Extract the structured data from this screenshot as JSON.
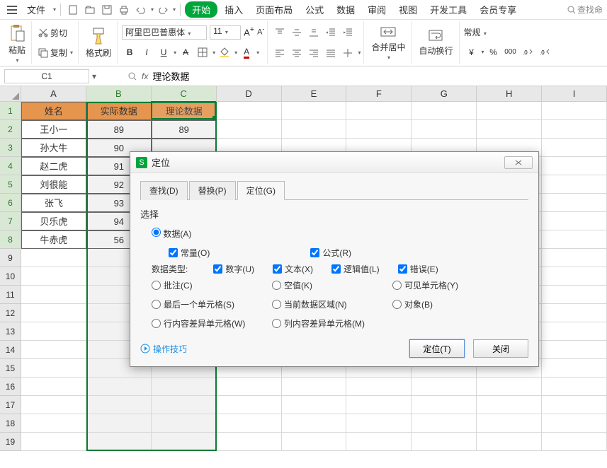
{
  "menubar": {
    "file": "文件",
    "tabs": [
      "开始",
      "插入",
      "页面布局",
      "公式",
      "数据",
      "审阅",
      "视图",
      "开发工具",
      "会员专享"
    ],
    "activeIndex": 0,
    "search_placeholder": "查找命"
  },
  "ribbon": {
    "paste": "粘贴",
    "cut": "剪切",
    "copy": "复制",
    "formatPainter": "格式刷",
    "fontName": "阿里巴巴普惠体",
    "fontSize": "11",
    "merge": "合并居中",
    "wrap": "自动换行",
    "numberFormat": "常规"
  },
  "cellRef": "C1",
  "fxLabel": "fx",
  "formula": "理论数据",
  "columns": [
    "A",
    "B",
    "C",
    "D",
    "E",
    "F",
    "G",
    "H",
    "I"
  ],
  "rowCount": 19,
  "table": {
    "headers": [
      "姓名",
      "实际数据",
      "理论数据"
    ],
    "rows": [
      {
        "a": "王小一",
        "b": "89",
        "c": "89"
      },
      {
        "a": "孙大牛",
        "b": "90",
        "c": ""
      },
      {
        "a": "赵二虎",
        "b": "91",
        "c": ""
      },
      {
        "a": "刘很能",
        "b": "92",
        "c": ""
      },
      {
        "a": "张飞",
        "b": "93",
        "c": ""
      },
      {
        "a": "贝乐虎",
        "b": "94",
        "c": ""
      },
      {
        "a": "牛赤虎",
        "b": "56",
        "c": ""
      }
    ]
  },
  "dialog": {
    "title": "定位",
    "tabs": {
      "find": "查找(D)",
      "replace": "替换(P)",
      "goto": "定位(G)"
    },
    "activeTab": 2,
    "selectLabel": "选择",
    "opts": {
      "data": "数据(A)",
      "const": "常量(O)",
      "formula": "公式(R)",
      "typesLabel": "数据类型:",
      "number": "数字(U)",
      "text": "文本(X)",
      "logical": "逻辑值(L)",
      "error": "错误(E)",
      "comment": "批注(C)",
      "blank": "空值(K)",
      "visible": "可见单元格(Y)",
      "lastCell": "最后一个单元格(S)",
      "currentRegion": "当前数据区域(N)",
      "object": "对象(B)",
      "rowDiff": "行内容差异单元格(W)",
      "colDiff": "列内容差异单元格(M)"
    },
    "tips": "操作技巧",
    "okBtn": "定位(T)",
    "closeBtn": "关闭"
  }
}
